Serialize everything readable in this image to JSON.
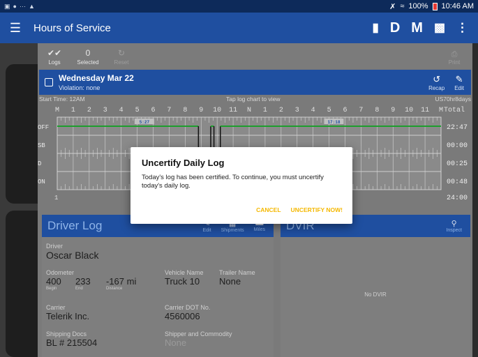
{
  "status_bar": {
    "time": "10:46 AM",
    "battery": "100%",
    "left_icons": [
      "image-icon",
      "chat-icon",
      "dots-icon",
      "android-icon"
    ]
  },
  "app": {
    "title": "Hours of Service",
    "actions": [
      "chat-icon",
      "D",
      "M",
      "inspection-icon",
      "overflow-icon"
    ]
  },
  "toolbar": {
    "logs_label": "Logs",
    "selected_count": "0",
    "selected_label": "Selected",
    "reset_label": "Reset",
    "right_label": "Print"
  },
  "day": {
    "date": "Wednesday Mar 22",
    "violation": "Violation: none",
    "recap_label": "Recap",
    "edit_label": "Edit"
  },
  "chart_info": {
    "start": "Start Time: 12AM",
    "hint": "Tap log chart to view",
    "rule": "US70hr8days"
  },
  "chart_data": {
    "type": "line",
    "hours": [
      "M",
      "1",
      "2",
      "3",
      "4",
      "5",
      "6",
      "7",
      "8",
      "9",
      "10",
      "11",
      "N",
      "1",
      "2",
      "3",
      "4",
      "5",
      "6",
      "7",
      "8",
      "9",
      "10",
      "11",
      "M"
    ],
    "total_label": "Total",
    "rows": [
      {
        "name": "OFF",
        "total": "22:47"
      },
      {
        "name": "SB",
        "total": "00:00"
      },
      {
        "name": "D",
        "total": "00:25"
      },
      {
        "name": "ON",
        "total": "00:48"
      }
    ],
    "grand_total": "24:00",
    "segments": [
      {
        "status": "OFF",
        "start": 0,
        "end": 8.83
      },
      {
        "status": "ON",
        "start": 8.83,
        "end": 9.6
      },
      {
        "status": "OFF",
        "start": 9.6,
        "end": 9.8
      },
      {
        "status": "D",
        "start": 9.8,
        "end": 10.2
      },
      {
        "status": "OFF",
        "start": 10.2,
        "end": 24
      }
    ],
    "markers": [
      {
        "hour": 5.45,
        "label": "5:27"
      },
      {
        "hour": 17.3,
        "label": "17:18"
      }
    ],
    "bottom_label": "1"
  },
  "driver_log": {
    "title": "Driver Log",
    "edit_label": "Edit",
    "shipments_label": "Shipments",
    "miles_label": "Miles",
    "driver_label": "Driver",
    "driver": "Oscar Black",
    "odometer_label": "Odometer",
    "begin": "400",
    "begin_label": "Begin",
    "end": "233",
    "end_label": "End",
    "distance": "-167 mi",
    "distance_label": "Distance",
    "vehicle_label": "Vehicle Name",
    "vehicle": "Truck 10",
    "trailer_label": "Trailer Name",
    "trailer": "None",
    "carrier_label": "Carrier",
    "carrier": "Telerik Inc.",
    "dot_label": "Carrier DOT No.",
    "dot": "4560006",
    "shipping_label": "Shipping Docs",
    "shipping": "BL # 215504",
    "shipper_label": "Shipper and Commodity",
    "shipper": "None"
  },
  "dvir": {
    "title": "DVIR",
    "inspect_label": "Inspect",
    "empty": "No DVIR"
  },
  "dialog": {
    "title": "Uncertify Daily Log",
    "message": "Today's log has been certified. To continue, you must uncertify today's daily log.",
    "cancel": "CANCEL",
    "confirm": "UNCERTIFY NOW!"
  },
  "colors": {
    "appbar": "#1f4fa0",
    "statusbar": "#0d2a5a",
    "accent": "#f5b800",
    "chart_line": "#1d9e2d"
  }
}
